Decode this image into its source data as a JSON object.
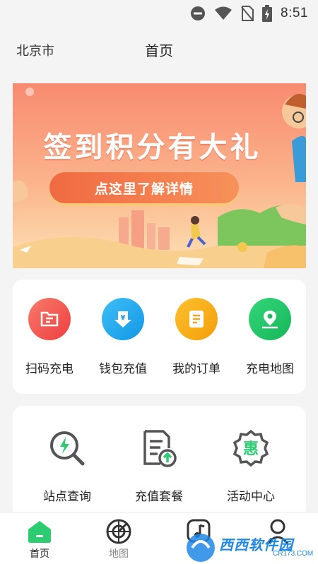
{
  "status_bar": {
    "time": "8:51",
    "icons": [
      "do-not-disturb-icon",
      "wifi-icon",
      "no-sim-icon",
      "battery-charging-icon"
    ]
  },
  "header": {
    "city": "北京市",
    "title": "首页"
  },
  "banner": {
    "headline": "签到积分有大礼",
    "cta": "点这里了解详情"
  },
  "quick_actions": [
    {
      "label": "扫码充电",
      "icon": "scan-icon",
      "color": "#f25353"
    },
    {
      "label": "钱包充值",
      "icon": "wallet-icon",
      "color": "#22a7f0"
    },
    {
      "label": "我的订单",
      "icon": "order-icon",
      "color": "#f9a825"
    },
    {
      "label": "充电地图",
      "icon": "map-pin-icon",
      "color": "#22c55e"
    }
  ],
  "features": [
    {
      "label": "站点查询",
      "icon": "station-search-icon"
    },
    {
      "label": "充值套餐",
      "icon": "recharge-package-icon"
    },
    {
      "label": "活动中心",
      "icon": "promotion-icon",
      "badge": "惠"
    }
  ],
  "tab_bar": [
    {
      "label": "首页",
      "icon": "home-icon",
      "active": true
    },
    {
      "label": "地图",
      "icon": "radar-map-icon",
      "active": false
    },
    {
      "label": "",
      "icon": "music-icon",
      "active": false
    },
    {
      "label": "",
      "icon": "profile-icon",
      "active": false
    }
  ],
  "watermark": {
    "text": "西西软件园",
    "sub": "CR173.COM"
  },
  "colors": {
    "accent": "#2ecc71",
    "background": "#f4f4f4"
  }
}
